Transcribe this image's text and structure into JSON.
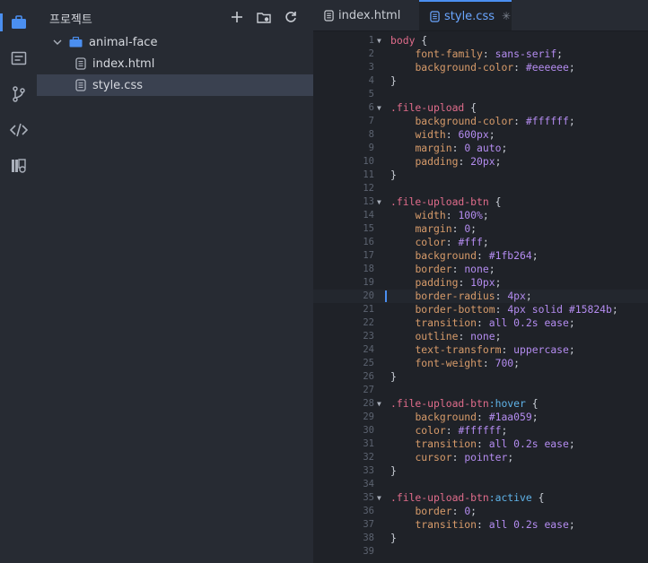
{
  "activity_bar": {
    "items": [
      {
        "name": "project-icon",
        "active": true
      },
      {
        "name": "outline-icon",
        "active": false
      },
      {
        "name": "source-control-icon",
        "active": false
      },
      {
        "name": "code-icon",
        "active": false
      },
      {
        "name": "extensions-icon",
        "active": false
      }
    ]
  },
  "sidebar": {
    "title": "프로젝트",
    "actions": [
      "new-file-icon",
      "new-folder-icon",
      "refresh-icon"
    ],
    "tree": {
      "folder": "animal-face",
      "files": [
        "index.html",
        "style.css"
      ],
      "selected": "style.css"
    }
  },
  "tabs": [
    {
      "label": "index.html",
      "active": false
    },
    {
      "label": "style.css",
      "active": true,
      "close": "✳"
    }
  ],
  "code": {
    "current_line": 20,
    "lines": [
      {
        "n": "1",
        "fold": "▼",
        "segs": [
          [
            "sel",
            "body"
          ],
          [
            "punc",
            " {"
          ]
        ]
      },
      {
        "n": "2",
        "fold": "",
        "segs": [
          [
            "punc",
            "    "
          ],
          [
            "prop",
            "font-family"
          ],
          [
            "punc",
            ": "
          ],
          [
            "val",
            "sans-serif"
          ],
          [
            "punc",
            ";"
          ]
        ]
      },
      {
        "n": "3",
        "fold": "",
        "segs": [
          [
            "punc",
            "    "
          ],
          [
            "prop",
            "background-color"
          ],
          [
            "punc",
            ": "
          ],
          [
            "val",
            "#eeeeee"
          ],
          [
            "punc",
            ";"
          ]
        ]
      },
      {
        "n": "4",
        "fold": "",
        "segs": [
          [
            "punc",
            "}"
          ]
        ]
      },
      {
        "n": "5",
        "fold": "",
        "segs": []
      },
      {
        "n": "6",
        "fold": "▼",
        "segs": [
          [
            "sel",
            ".file-upload"
          ],
          [
            "punc",
            " {"
          ]
        ]
      },
      {
        "n": "7",
        "fold": "",
        "segs": [
          [
            "punc",
            "    "
          ],
          [
            "prop",
            "background-color"
          ],
          [
            "punc",
            ": "
          ],
          [
            "val",
            "#ffffff"
          ],
          [
            "punc",
            ";"
          ]
        ]
      },
      {
        "n": "8",
        "fold": "",
        "segs": [
          [
            "punc",
            "    "
          ],
          [
            "prop",
            "width"
          ],
          [
            "punc",
            ": "
          ],
          [
            "val",
            "600px"
          ],
          [
            "punc",
            ";"
          ]
        ]
      },
      {
        "n": "9",
        "fold": "",
        "segs": [
          [
            "punc",
            "    "
          ],
          [
            "prop",
            "margin"
          ],
          [
            "punc",
            ": "
          ],
          [
            "val",
            "0 auto"
          ],
          [
            "punc",
            ";"
          ]
        ]
      },
      {
        "n": "10",
        "fold": "",
        "segs": [
          [
            "punc",
            "    "
          ],
          [
            "prop",
            "padding"
          ],
          [
            "punc",
            ": "
          ],
          [
            "val",
            "20px"
          ],
          [
            "punc",
            ";"
          ]
        ]
      },
      {
        "n": "11",
        "fold": "",
        "segs": [
          [
            "punc",
            "}"
          ]
        ]
      },
      {
        "n": "12",
        "fold": "",
        "segs": []
      },
      {
        "n": "13",
        "fold": "▼",
        "segs": [
          [
            "sel",
            ".file-upload-btn"
          ],
          [
            "punc",
            " {"
          ]
        ]
      },
      {
        "n": "14",
        "fold": "",
        "segs": [
          [
            "punc",
            "    "
          ],
          [
            "prop",
            "width"
          ],
          [
            "punc",
            ": "
          ],
          [
            "val",
            "100%"
          ],
          [
            "punc",
            ";"
          ]
        ]
      },
      {
        "n": "15",
        "fold": "",
        "segs": [
          [
            "punc",
            "    "
          ],
          [
            "prop",
            "margin"
          ],
          [
            "punc",
            ": "
          ],
          [
            "val",
            "0"
          ],
          [
            "punc",
            ";"
          ]
        ]
      },
      {
        "n": "16",
        "fold": "",
        "segs": [
          [
            "punc",
            "    "
          ],
          [
            "prop",
            "color"
          ],
          [
            "punc",
            ": "
          ],
          [
            "val",
            "#fff"
          ],
          [
            "punc",
            ";"
          ]
        ]
      },
      {
        "n": "17",
        "fold": "",
        "segs": [
          [
            "punc",
            "    "
          ],
          [
            "prop",
            "background"
          ],
          [
            "punc",
            ": "
          ],
          [
            "val",
            "#1fb264"
          ],
          [
            "punc",
            ";"
          ]
        ]
      },
      {
        "n": "18",
        "fold": "",
        "segs": [
          [
            "punc",
            "    "
          ],
          [
            "prop",
            "border"
          ],
          [
            "punc",
            ": "
          ],
          [
            "val",
            "none"
          ],
          [
            "punc",
            ";"
          ]
        ]
      },
      {
        "n": "19",
        "fold": "",
        "segs": [
          [
            "punc",
            "    "
          ],
          [
            "prop",
            "padding"
          ],
          [
            "punc",
            ": "
          ],
          [
            "val",
            "10px"
          ],
          [
            "punc",
            ";"
          ]
        ]
      },
      {
        "n": "20",
        "fold": "",
        "segs": [
          [
            "punc",
            "    "
          ],
          [
            "prop",
            "border-radius"
          ],
          [
            "punc",
            ": "
          ],
          [
            "val",
            "4px"
          ],
          [
            "punc",
            ";"
          ]
        ]
      },
      {
        "n": "21",
        "fold": "",
        "segs": [
          [
            "punc",
            "    "
          ],
          [
            "prop",
            "border-bottom"
          ],
          [
            "punc",
            ": "
          ],
          [
            "val",
            "4px solid #15824b"
          ],
          [
            "punc",
            ";"
          ]
        ]
      },
      {
        "n": "22",
        "fold": "",
        "segs": [
          [
            "punc",
            "    "
          ],
          [
            "prop",
            "transition"
          ],
          [
            "punc",
            ": "
          ],
          [
            "val",
            "all 0.2s ease"
          ],
          [
            "punc",
            ";"
          ]
        ]
      },
      {
        "n": "23",
        "fold": "",
        "segs": [
          [
            "punc",
            "    "
          ],
          [
            "prop",
            "outline"
          ],
          [
            "punc",
            ": "
          ],
          [
            "val",
            "none"
          ],
          [
            "punc",
            ";"
          ]
        ]
      },
      {
        "n": "24",
        "fold": "",
        "segs": [
          [
            "punc",
            "    "
          ],
          [
            "prop",
            "text-transform"
          ],
          [
            "punc",
            ": "
          ],
          [
            "val",
            "uppercase"
          ],
          [
            "punc",
            ";"
          ]
        ]
      },
      {
        "n": "25",
        "fold": "",
        "segs": [
          [
            "punc",
            "    "
          ],
          [
            "prop",
            "font-weight"
          ],
          [
            "punc",
            ": "
          ],
          [
            "val",
            "700"
          ],
          [
            "punc",
            ";"
          ]
        ]
      },
      {
        "n": "26",
        "fold": "",
        "segs": [
          [
            "punc",
            "}"
          ]
        ]
      },
      {
        "n": "27",
        "fold": "",
        "segs": []
      },
      {
        "n": "28",
        "fold": "▼",
        "segs": [
          [
            "sel",
            ".file-upload-btn"
          ],
          [
            "pseudo",
            ":hover"
          ],
          [
            "punc",
            " {"
          ]
        ]
      },
      {
        "n": "29",
        "fold": "",
        "segs": [
          [
            "punc",
            "    "
          ],
          [
            "prop",
            "background"
          ],
          [
            "punc",
            ": "
          ],
          [
            "val",
            "#1aa059"
          ],
          [
            "punc",
            ";"
          ]
        ]
      },
      {
        "n": "30",
        "fold": "",
        "segs": [
          [
            "punc",
            "    "
          ],
          [
            "prop",
            "color"
          ],
          [
            "punc",
            ": "
          ],
          [
            "val",
            "#ffffff"
          ],
          [
            "punc",
            ";"
          ]
        ]
      },
      {
        "n": "31",
        "fold": "",
        "segs": [
          [
            "punc",
            "    "
          ],
          [
            "prop",
            "transition"
          ],
          [
            "punc",
            ": "
          ],
          [
            "val",
            "all 0.2s ease"
          ],
          [
            "punc",
            ";"
          ]
        ]
      },
      {
        "n": "32",
        "fold": "",
        "segs": [
          [
            "punc",
            "    "
          ],
          [
            "prop",
            "cursor"
          ],
          [
            "punc",
            ": "
          ],
          [
            "val",
            "pointer"
          ],
          [
            "punc",
            ";"
          ]
        ]
      },
      {
        "n": "33",
        "fold": "",
        "segs": [
          [
            "punc",
            "}"
          ]
        ]
      },
      {
        "n": "34",
        "fold": "",
        "segs": []
      },
      {
        "n": "35",
        "fold": "▼",
        "segs": [
          [
            "sel",
            ".file-upload-btn"
          ],
          [
            "pseudo",
            ":active"
          ],
          [
            "punc",
            " {"
          ]
        ]
      },
      {
        "n": "36",
        "fold": "",
        "segs": [
          [
            "punc",
            "    "
          ],
          [
            "prop",
            "border"
          ],
          [
            "punc",
            ": "
          ],
          [
            "val",
            "0"
          ],
          [
            "punc",
            ";"
          ]
        ]
      },
      {
        "n": "37",
        "fold": "",
        "segs": [
          [
            "punc",
            "    "
          ],
          [
            "prop",
            "transition"
          ],
          [
            "punc",
            ": "
          ],
          [
            "val",
            "all 0.2s ease"
          ],
          [
            "punc",
            ";"
          ]
        ]
      },
      {
        "n": "38",
        "fold": "",
        "segs": [
          [
            "punc",
            "}"
          ]
        ]
      },
      {
        "n": "39",
        "fold": "",
        "segs": []
      }
    ]
  },
  "colors": {
    "accent": "#4b8ff0",
    "selector": "#e06c8b",
    "property": "#d79b6a",
    "value": "#b48cf0",
    "pseudo": "#5fb3e8",
    "folder": "#4b8ff0"
  }
}
